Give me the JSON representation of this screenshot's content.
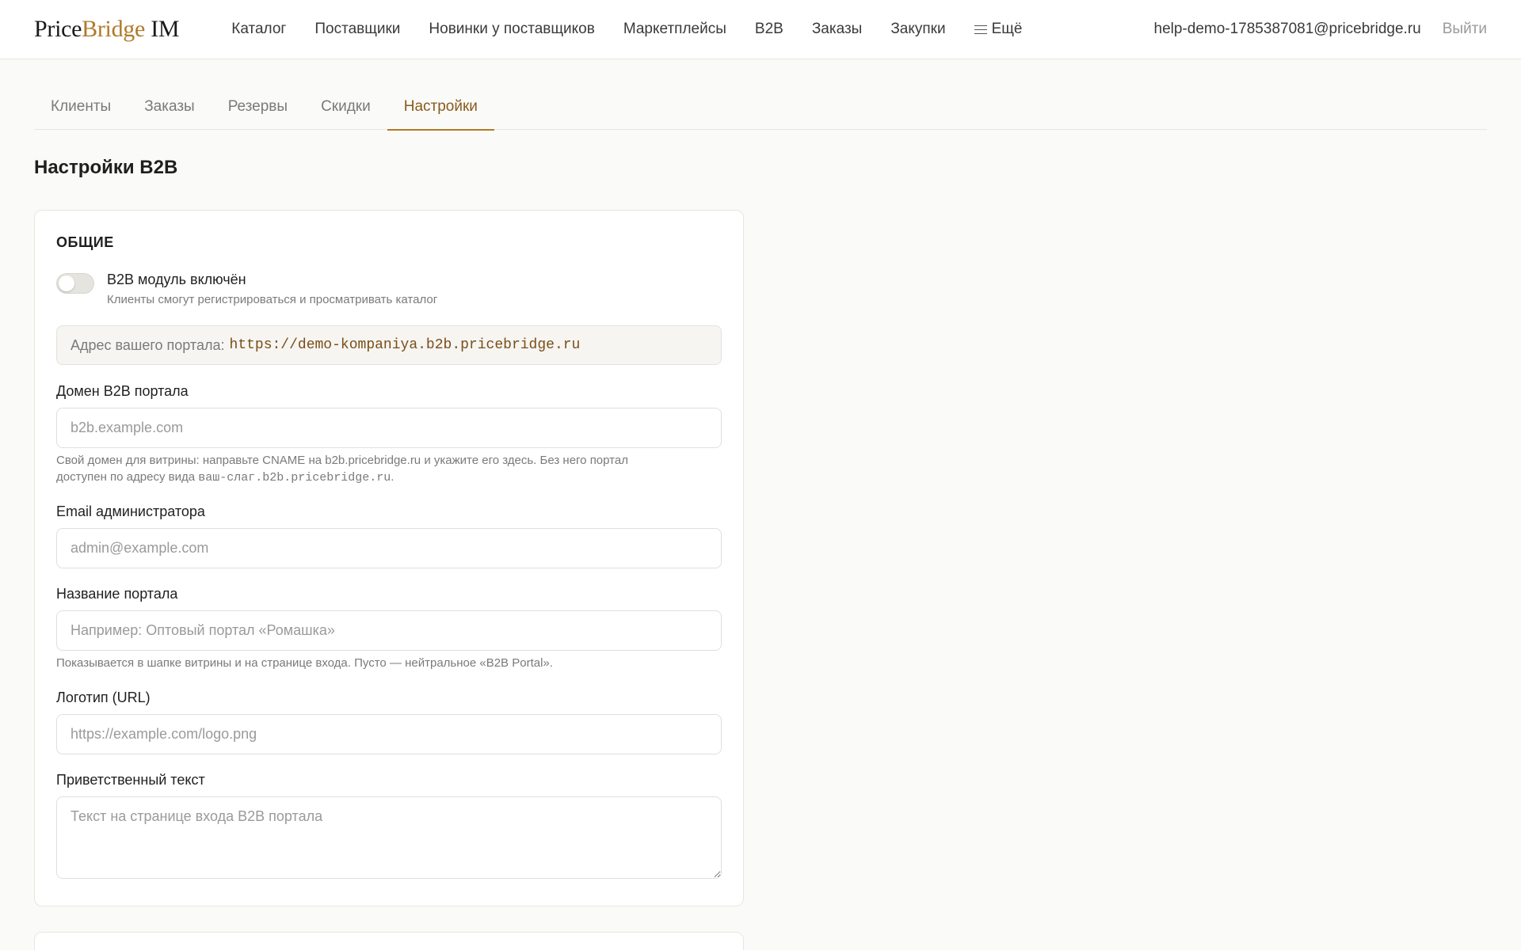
{
  "header": {
    "logo_part1": "Price",
    "logo_part2": "Bridge",
    "logo_part3": " IM",
    "nav": [
      "Каталог",
      "Поставщики",
      "Новинки у поставщиков",
      "Маркетплейсы",
      "B2B",
      "Заказы",
      "Закупки"
    ],
    "more_label": "Ещё",
    "user_email": "help-demo-1785387081@pricebridge.ru",
    "logout_label": "Выйти"
  },
  "subtabs": [
    "Клиенты",
    "Заказы",
    "Резервы",
    "Скидки",
    "Настройки"
  ],
  "active_subtab": "Настройки",
  "page_title": "Настройки B2B",
  "general": {
    "section_title": "ОБЩИЕ",
    "toggle_label": "B2B модуль включён",
    "toggle_desc": "Клиенты смогут регистрироваться и просматривать каталог",
    "toggle_on": false,
    "portal_label": "Адрес вашего портала:",
    "portal_url": "https://demo-kompaniya.b2b.pricebridge.ru",
    "domain": {
      "label": "Домен B2B портала",
      "placeholder": "b2b.example.com",
      "value": "",
      "hint_line1": "Свой домен для витрины: направьте CNAME на b2b.pricebridge.ru и укажите его здесь. Без него портал",
      "hint_line2_prefix": "доступен по адресу вида ",
      "hint_mono": "ваш-слаг.b2b.pricebridge.ru",
      "hint_suffix": "."
    },
    "admin_email": {
      "label": "Email администратора",
      "placeholder": "admin@example.com",
      "value": ""
    },
    "portal_name": {
      "label": "Название портала",
      "placeholder": "Например: Оптовый портал «Ромашка»",
      "value": "",
      "hint": "Показывается в шапке витрины и на странице входа. Пусто — нейтральное «B2B Portal»."
    },
    "logo_url": {
      "label": "Логотип (URL)",
      "placeholder": "https://example.com/logo.png",
      "value": ""
    },
    "welcome_text": {
      "label": "Приветственный текст",
      "placeholder": "Текст на странице входа B2B портала",
      "value": ""
    }
  },
  "colors": {
    "accent": "#b07a2a",
    "active_tab": "#8a5a1c",
    "url_text": "#7a4e16"
  }
}
